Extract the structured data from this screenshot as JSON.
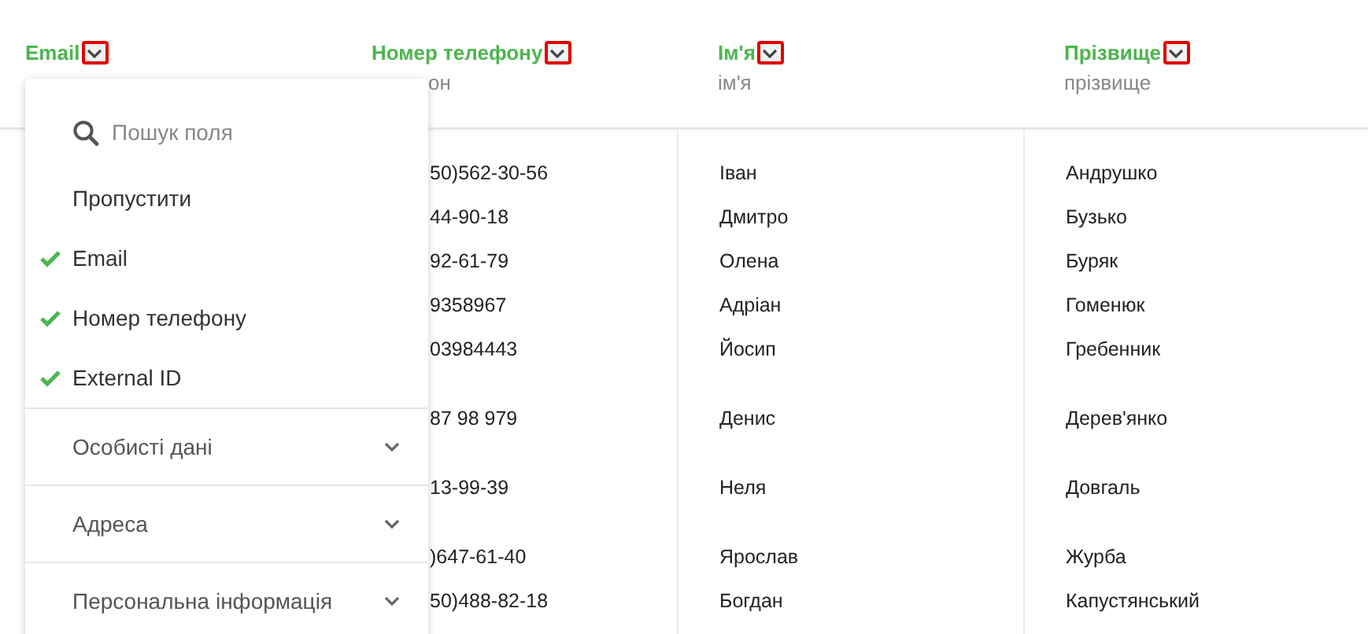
{
  "columns": [
    {
      "title": "Email"
    },
    {
      "title": "Номер телефону",
      "subtitle": "он"
    },
    {
      "title": "Ім'я",
      "subtitle": "ім'я"
    },
    {
      "title": "Прізвище",
      "subtitle": "прізвище"
    }
  ],
  "rows": [
    {
      "kind": "single",
      "cells": [
        null,
        "50)562-30-56",
        "Іван",
        "Андрушко"
      ]
    },
    {
      "kind": "single",
      "cells": [
        null,
        "44-90-18",
        "Дмитро",
        "Бузько"
      ]
    },
    {
      "kind": "single",
      "cells": [
        null,
        "92-61-79",
        "Олена",
        "Буряк"
      ]
    },
    {
      "kind": "single",
      "cells": [
        null,
        "9358967",
        "Адріан",
        "Гоменюк"
      ]
    },
    {
      "kind": "multiline",
      "cells": [
        null,
        "03984443",
        "Йосип",
        "Гребенник"
      ]
    },
    {
      "kind": "multiline",
      "cells": [
        null,
        "87 98 979",
        "Денис",
        "Дерев'янко"
      ]
    },
    {
      "kind": "multiline",
      "cells": [
        null,
        "13-99-39",
        "Неля",
        "Довгаль"
      ]
    },
    {
      "kind": "single",
      "cells": [
        null,
        ")647-61-40",
        "Ярослав",
        "Журба"
      ]
    },
    {
      "kind": "single",
      "cells": [
        null,
        "50)488-82-18",
        "Богдан",
        "Капустянський"
      ]
    }
  ],
  "dropdown": {
    "search": {
      "placeholder": "Пошук поля"
    },
    "options": [
      {
        "label": "Пропустити",
        "checked": false
      },
      {
        "label": "Email",
        "checked": true
      },
      {
        "label": "Номер телефону",
        "checked": true
      },
      {
        "label": "External ID",
        "checked": true
      }
    ],
    "groups": [
      {
        "label": "Особисті дані",
        "expanded": false
      },
      {
        "label": "Адреса",
        "expanded": false
      },
      {
        "label": "Персональна інформація",
        "expanded": false
      }
    ]
  }
}
